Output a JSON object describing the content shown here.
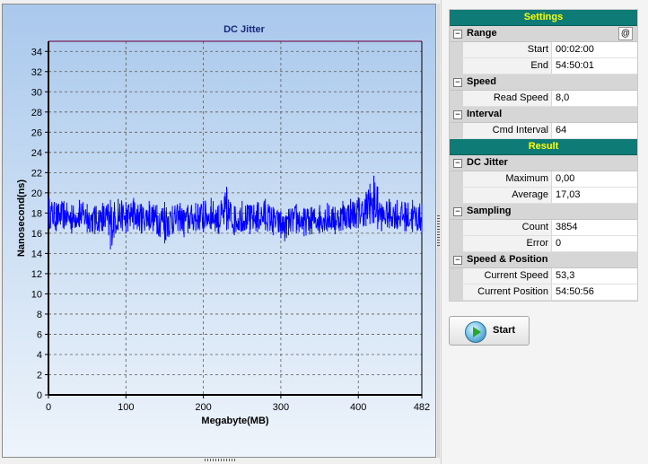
{
  "chart": {
    "title": "DC Jitter",
    "xlabel": "Megabyte(MB)",
    "ylabel": "Nanosecond(ns)",
    "x_ticks": [
      "0",
      "100",
      "200",
      "300",
      "400",
      "482"
    ],
    "y_ticks": [
      "0",
      "2",
      "4",
      "6",
      "8",
      "10",
      "12",
      "14",
      "16",
      "18",
      "20",
      "22",
      "24",
      "26",
      "28",
      "30",
      "32",
      "34"
    ]
  },
  "chart_data": {
    "type": "line",
    "title": "DC Jitter",
    "xlabel": "Megabyte(MB)",
    "ylabel": "Nanosecond(ns)",
    "xlim": [
      0,
      482
    ],
    "ylim": [
      0,
      35
    ],
    "grid": true,
    "series": [
      {
        "color": "#0000ff",
        "x": [
          0,
          10,
          20,
          30,
          40,
          50,
          60,
          70,
          80,
          90,
          100,
          110,
          120,
          130,
          140,
          150,
          160,
          170,
          175,
          180,
          190,
          200,
          210,
          220,
          230,
          240,
          250,
          260,
          270,
          280,
          290,
          300,
          305,
          310,
          320,
          330,
          340,
          350,
          360,
          370,
          380,
          390,
          400,
          410,
          415,
          420,
          425,
          430,
          440,
          450,
          460,
          470,
          482
        ],
        "y": [
          18.0,
          17.6,
          17.8,
          17.4,
          17.9,
          17.5,
          17.3,
          17.6,
          16.8,
          17.7,
          17.5,
          17.8,
          17.4,
          17.7,
          17.3,
          17.6,
          17.2,
          17.6,
          17.5,
          17.4,
          17.5,
          17.6,
          17.8,
          17.3,
          17.7,
          17.2,
          17.6,
          17.3,
          17.5,
          17.7,
          17.2,
          17.0,
          16.9,
          17.2,
          17.4,
          17.1,
          17.3,
          17.4,
          17.6,
          17.3,
          17.7,
          17.8,
          17.9,
          18.1,
          18.5,
          19.2,
          18.3,
          17.6,
          17.9,
          17.8,
          17.6,
          17.5,
          17.4
        ],
        "y_min": [
          16.5,
          16.2,
          16.4,
          16.0,
          16.6,
          16.1,
          15.9,
          16.2,
          14.4,
          16.3,
          16.0,
          16.4,
          16.0,
          16.3,
          15.9,
          15.0,
          15.9,
          16.2,
          15.6,
          16.0,
          16.2,
          16.1,
          16.4,
          15.9,
          16.3,
          15.8,
          16.2,
          15.9,
          16.1,
          16.3,
          15.8,
          15.5,
          15.2,
          15.8,
          16.0,
          15.7,
          15.9,
          16.0,
          16.2,
          15.9,
          16.3,
          16.4,
          16.5,
          16.7,
          16.9,
          17.0,
          16.4,
          16.2,
          16.5,
          16.4,
          16.2,
          16.1,
          16.0
        ],
        "y_max": [
          19.6,
          19.0,
          19.2,
          18.8,
          19.3,
          18.9,
          18.7,
          19.0,
          19.3,
          19.4,
          19.1,
          19.5,
          18.9,
          19.2,
          18.8,
          19.1,
          18.7,
          19.0,
          18.3,
          18.8,
          19.0,
          19.2,
          19.5,
          18.8,
          20.6,
          18.7,
          19.2,
          18.8,
          19.1,
          19.4,
          18.6,
          18.2,
          17.6,
          18.4,
          18.9,
          18.5,
          18.6,
          18.8,
          19.0,
          18.6,
          19.2,
          19.4,
          19.6,
          20.1,
          20.9,
          21.7,
          20.6,
          18.9,
          19.4,
          19.3,
          19.1,
          19.3,
          18.9
        ]
      }
    ]
  },
  "settings": {
    "header": "Settings",
    "range": {
      "label": "Range",
      "at_button": "@",
      "start_label": "Start",
      "start_value": "00:02:00",
      "end_label": "End",
      "end_value": "54:50:01"
    },
    "speed": {
      "label": "Speed",
      "read_speed_label": "Read Speed",
      "read_speed_value": "8,0"
    },
    "interval": {
      "label": "Interval",
      "cmd_interval_label": "Cmd Interval",
      "cmd_interval_value": "64"
    }
  },
  "result": {
    "header": "Result",
    "dc_jitter": {
      "label": "DC Jitter",
      "maximum_label": "Maximum",
      "maximum_value": "0,00",
      "average_label": "Average",
      "average_value": "17,03"
    },
    "sampling": {
      "label": "Sampling",
      "count_label": "Count",
      "count_value": "3854",
      "error_label": "Error",
      "error_value": "0"
    },
    "speed_position": {
      "label": "Speed & Position",
      "current_speed_label": "Current Speed",
      "current_speed_value": "53,3",
      "current_position_label": "Current Position",
      "current_position_value": "54:50:56"
    }
  },
  "start_button": {
    "label": "Start"
  },
  "colors": {
    "header_bg": "#0e7b76",
    "header_text": "#ffff00",
    "series": "#0000ff"
  },
  "icons": {
    "play": "play-icon"
  }
}
